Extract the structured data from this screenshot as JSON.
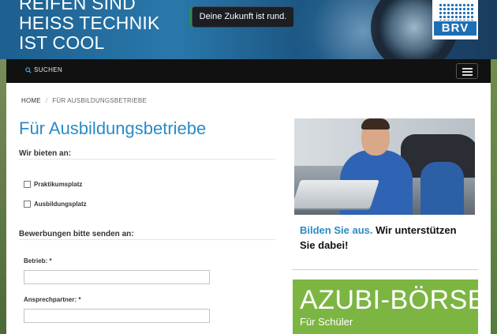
{
  "hero": {
    "headline_lines": [
      "REIFEN SIND",
      "HEISS TECHNIK",
      "IST COOL"
    ],
    "slogan": "Deine Zukunft ist rund.",
    "logo_text": "BRV"
  },
  "nav": {
    "search_label": "SUCHEN"
  },
  "breadcrumb": {
    "home": "HOME",
    "separator": "/",
    "current": "FÜR AUSBILDUNGSBETRIEBE"
  },
  "main": {
    "title": "Für Ausbildungsbetriebe",
    "offer_heading": "Wir bieten an:",
    "offer_options": [
      {
        "label": "Praktikumsplatz",
        "checked": false
      },
      {
        "label": "Ausbildungsplatz",
        "checked": false
      }
    ],
    "send_heading": "Bewerbungen bitte senden an:",
    "fields": [
      {
        "label": "Betrieb: *",
        "value": "",
        "placeholder": ""
      },
      {
        "label": "Ansprechpartner: *",
        "value": "",
        "placeholder": ""
      }
    ]
  },
  "sidebar": {
    "promo_highlight": "Bilden Sie aus.",
    "promo_rest": "Wir unterstützen Sie dabei!",
    "azubi_title": "AZUBI-BÖRSE",
    "azubi_sub": "Für Schüler"
  },
  "colors": {
    "accent_blue": "#2a8bc6",
    "azubi_green": "#7db543",
    "navbar": "#111111"
  }
}
